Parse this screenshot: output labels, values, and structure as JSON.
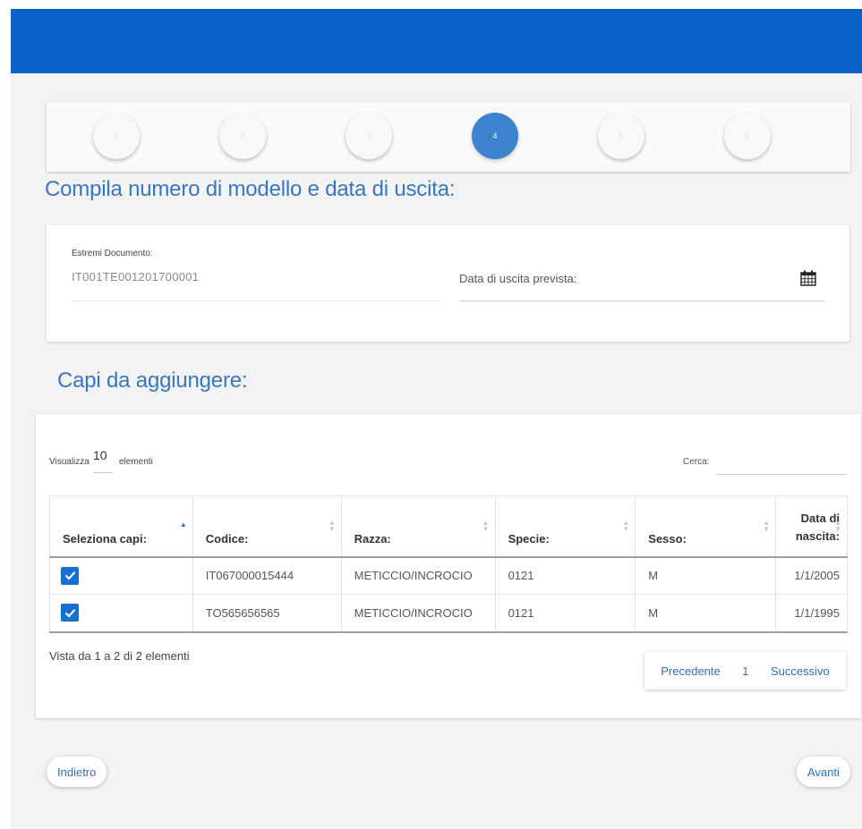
{
  "colors": {
    "header": "#0a64c8",
    "accent": "#3777c2",
    "checkbox": "#1470d3"
  },
  "stepper": {
    "steps": [
      {
        "label": "1",
        "active": false
      },
      {
        "label": "2",
        "active": false
      },
      {
        "label": "3",
        "active": false
      },
      {
        "label": "4",
        "active": true
      },
      {
        "label": "5",
        "active": false
      },
      {
        "label": "6",
        "active": false
      }
    ]
  },
  "doc_section": {
    "title": "Compila numero di modello e data di uscita:",
    "estremi_label": "Estremi Documento:",
    "estremi_value": "IT001TE001201700001",
    "date_label": "Data di uscita prevista:",
    "date_icon": "calendar-icon"
  },
  "capi_section": {
    "title": "Capi da aggiungere:",
    "show_label": "Visualizza",
    "show_count": "10",
    "show_suffix": "elementi",
    "search_label": "Cerca:",
    "search_value": "",
    "columns": [
      "Seleziona capi:",
      "Codice:",
      "Razza:",
      "Specie:",
      "Sesso:",
      "Data di nascita:"
    ],
    "sorted_column": 0,
    "rows": [
      {
        "selected": true,
        "codice": "IT067000015444",
        "razza": "METICCIO/INCROCIO",
        "specie": "0121",
        "sesso": "M",
        "nascita": "1/1/2005"
      },
      {
        "selected": true,
        "codice": "TO565656565",
        "razza": "METICCIO/INCROCIO",
        "specie": "0121",
        "sesso": "M",
        "nascita": "1/1/1995"
      }
    ],
    "info": "Vista da 1 a 2 di 2 elementi",
    "pager": {
      "prev": "Precedente",
      "page": "1",
      "next": "Successivo"
    }
  },
  "nav": {
    "back": "Indietro",
    "next": "Avanti"
  }
}
